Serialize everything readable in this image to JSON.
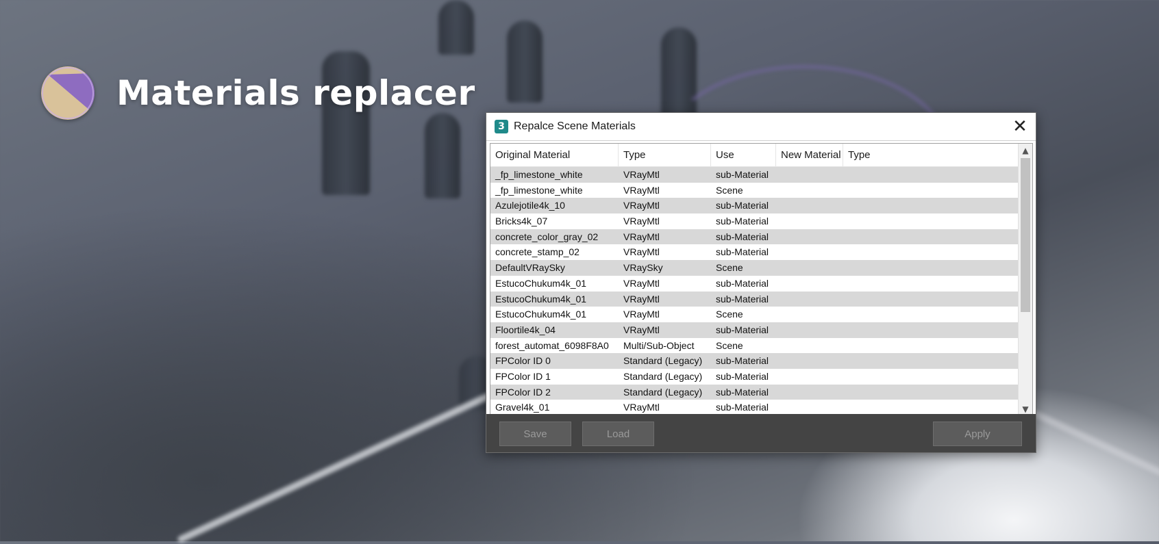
{
  "banner": {
    "title": "Materials replacer",
    "logo": "materials-replacer-logo"
  },
  "dialog": {
    "title": "Repalce Scene Materials",
    "app_icon": "3",
    "close_glyph": "✕",
    "columns": [
      "Original Material",
      "Type",
      "Use",
      "New Material",
      "Type"
    ],
    "rows": [
      [
        "_fp_limestone_white",
        "VRayMtl",
        "sub-Material",
        "",
        ""
      ],
      [
        "_fp_limestone_white",
        "VRayMtl",
        "Scene",
        "",
        ""
      ],
      [
        "Azulejotile4k_10",
        "VRayMtl",
        "sub-Material",
        "",
        ""
      ],
      [
        "Bricks4k_07",
        "VRayMtl",
        "sub-Material",
        "",
        ""
      ],
      [
        "concrete_color_gray_02",
        "VRayMtl",
        "sub-Material",
        "",
        ""
      ],
      [
        "concrete_stamp_02",
        "VRayMtl",
        "sub-Material",
        "",
        ""
      ],
      [
        "DefaultVRaySky",
        "VRaySky",
        "Scene",
        "",
        ""
      ],
      [
        "EstucoChukum4k_01",
        "VRayMtl",
        "sub-Material",
        "",
        ""
      ],
      [
        "EstucoChukum4k_01",
        "VRayMtl",
        "sub-Material",
        "",
        ""
      ],
      [
        "EstucoChukum4k_01",
        "VRayMtl",
        "Scene",
        "",
        ""
      ],
      [
        "Floortile4k_04",
        "VRayMtl",
        "sub-Material",
        "",
        ""
      ],
      [
        "forest_automat_6098F8A0",
        "Multi/Sub-Object",
        "Scene",
        "",
        ""
      ],
      [
        "FPColor ID 0",
        "Standard (Legacy)",
        "sub-Material",
        "",
        ""
      ],
      [
        "FPColor ID 1",
        "Standard (Legacy)",
        "sub-Material",
        "",
        ""
      ],
      [
        "FPColor ID 2",
        "Standard (Legacy)",
        "sub-Material",
        "",
        ""
      ],
      [
        "Gravel4k_01",
        "VRayMtl",
        "sub-Material",
        "",
        ""
      ]
    ],
    "scroll_up": "▲",
    "scroll_down": "▼",
    "buttons": {
      "save": "Save",
      "load": "Load",
      "apply": "Apply"
    }
  },
  "colors": {
    "accent_logo_purple": "#8e6cc0",
    "accent_logo_beige": "#d9c29a",
    "footer_bg": "#444444"
  }
}
